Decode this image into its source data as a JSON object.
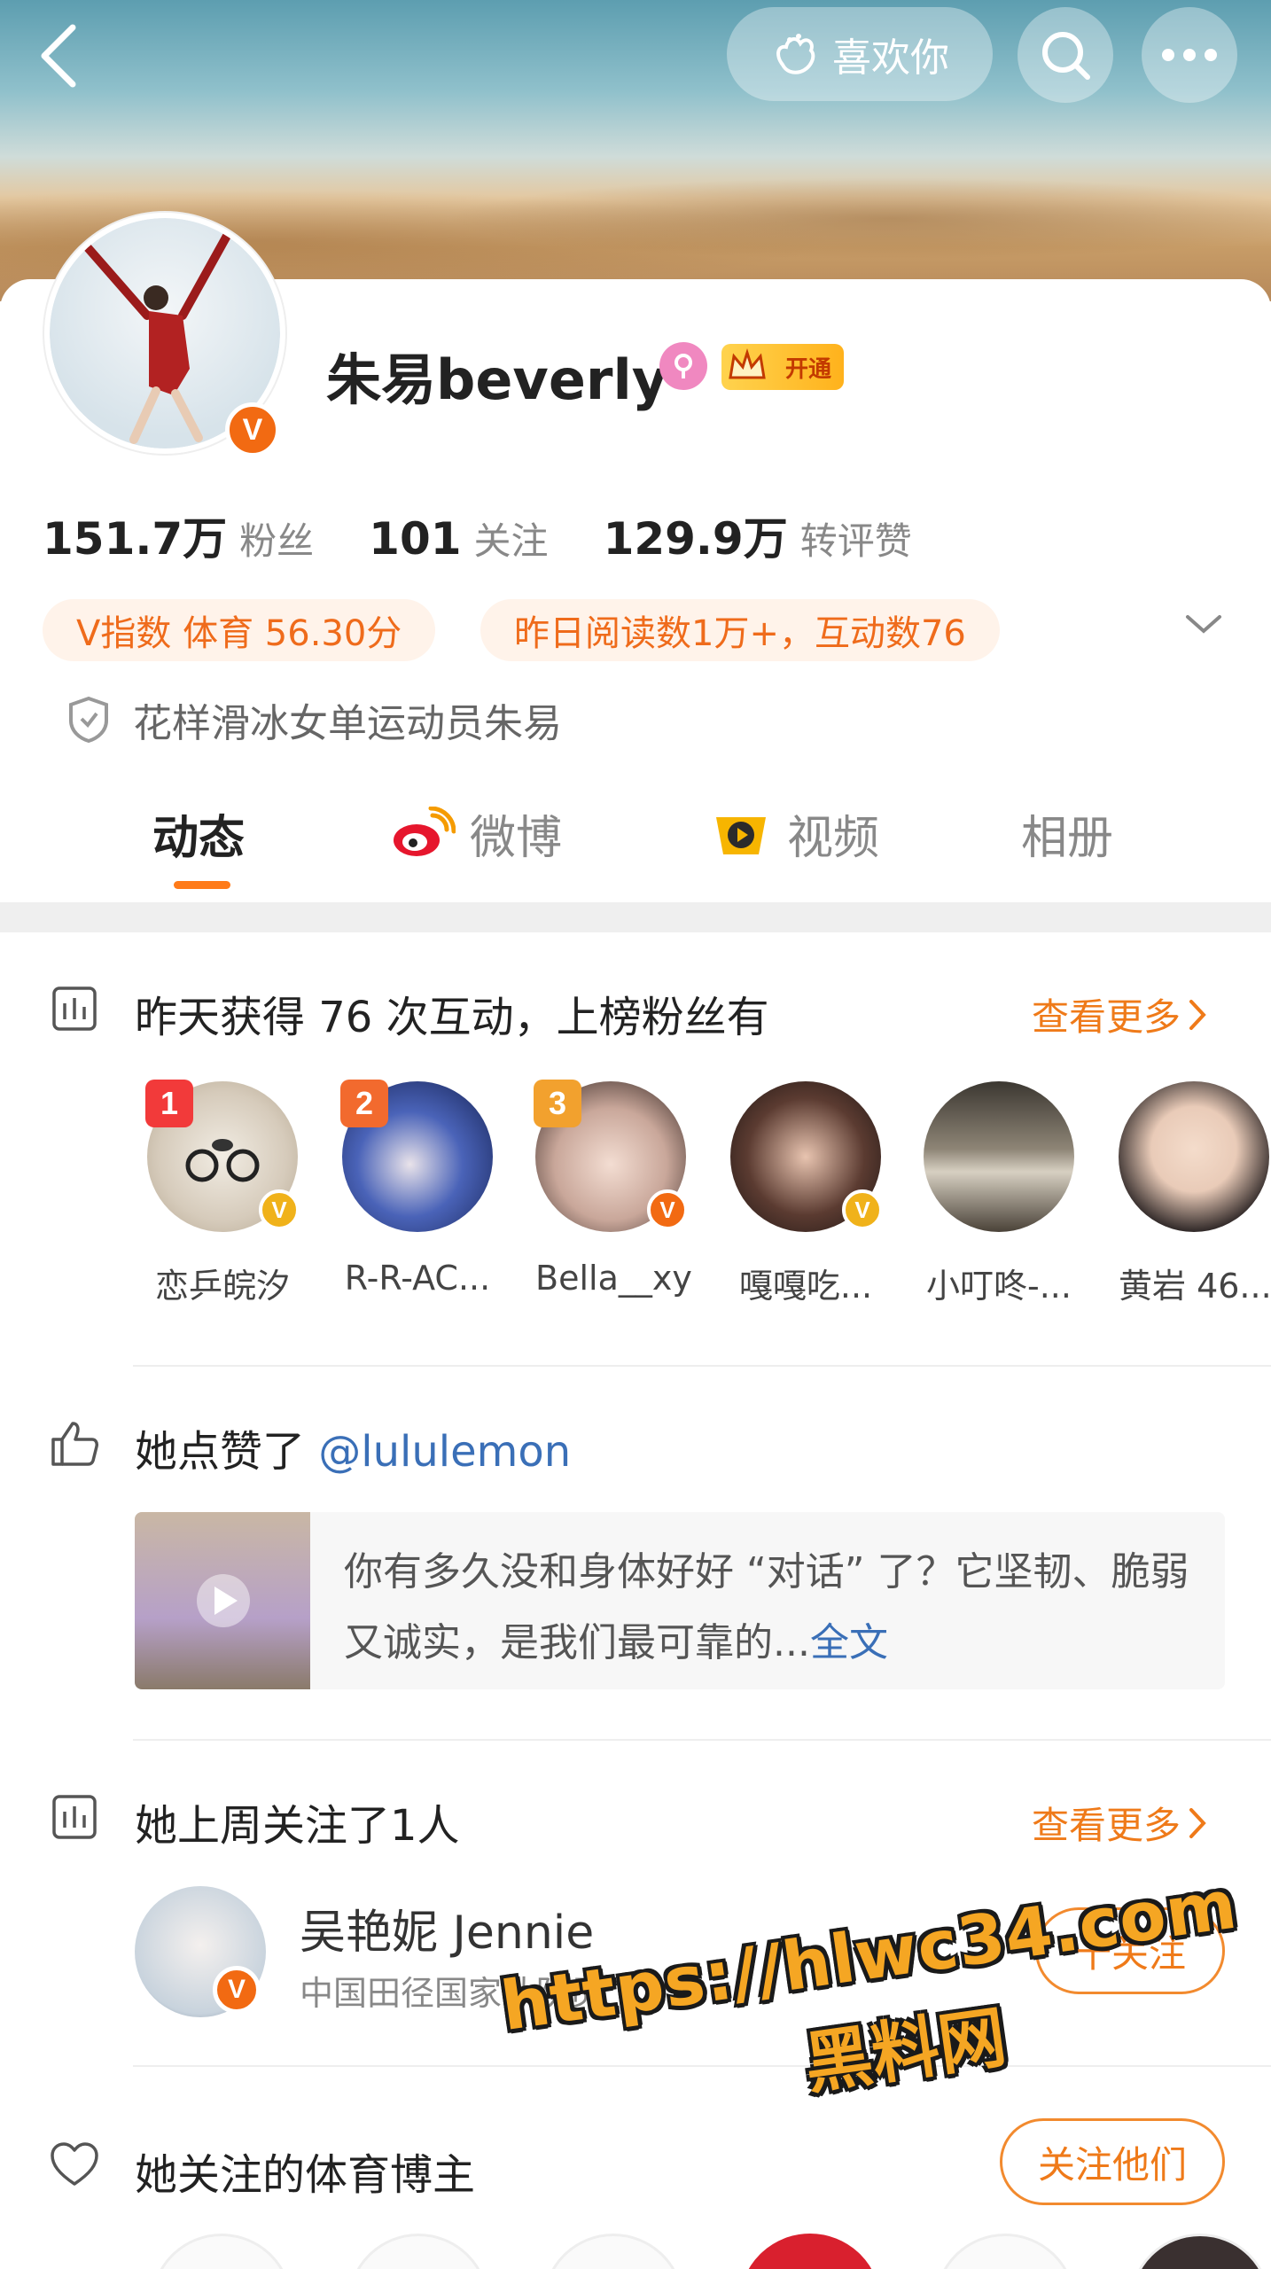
{
  "header": {
    "like_label": "喜欢你"
  },
  "profile": {
    "name": "朱易beverly",
    "vip_label": "开通",
    "stats": [
      {
        "value": "151.7万",
        "label": "粉丝"
      },
      {
        "value": "101",
        "label": "关注"
      },
      {
        "value": "129.9万",
        "label": "转评赞"
      }
    ],
    "tags": [
      "V指数 体育 56.30分",
      "昨日阅读数1万+，互动数76"
    ],
    "intro": "花样滑冰女单运动员朱易"
  },
  "tabs": [
    {
      "label": "动态",
      "active": true
    },
    {
      "label": "微博",
      "active": false
    },
    {
      "label": "视频",
      "active": false
    },
    {
      "label": "相册",
      "active": false
    }
  ],
  "fans_section": {
    "title": "昨天获得 76 次互动，上榜粉丝有",
    "more": "查看更多",
    "fans": [
      {
        "name": "恋乒皖汐",
        "rank": "1"
      },
      {
        "name": "R-R-AC...",
        "rank": "2"
      },
      {
        "name": "Bella__xy",
        "rank": "3"
      },
      {
        "name": "嘎嘎吃...",
        "rank": ""
      },
      {
        "name": "小叮咚-...",
        "rank": ""
      },
      {
        "name": "黄岩 46...",
        "rank": ""
      }
    ]
  },
  "like_section": {
    "prefix": "她点赞了 ",
    "mention": "@lululemon",
    "post_text": "你有多久没和身体好好 “对话” 了？它坚韧、脆弱又诚实，是我们最可靠的...",
    "full_text_link": "全文"
  },
  "follow_section": {
    "title": "她上周关注了1人",
    "more": "查看更多",
    "user_name": "吴艳妮 Jennie",
    "user_desc": "中国田径国家队队员",
    "follow_btn": "十关注"
  },
  "sports_section": {
    "title": "她关注的体育博主",
    "follow_all_btn": "关注他们"
  },
  "watermark": {
    "url": "https://hlwc34.com",
    "site": "黑料网"
  },
  "colors": {
    "accent": "#ef7a19",
    "link": "#3a6fb7",
    "verified": "#f26a12"
  }
}
